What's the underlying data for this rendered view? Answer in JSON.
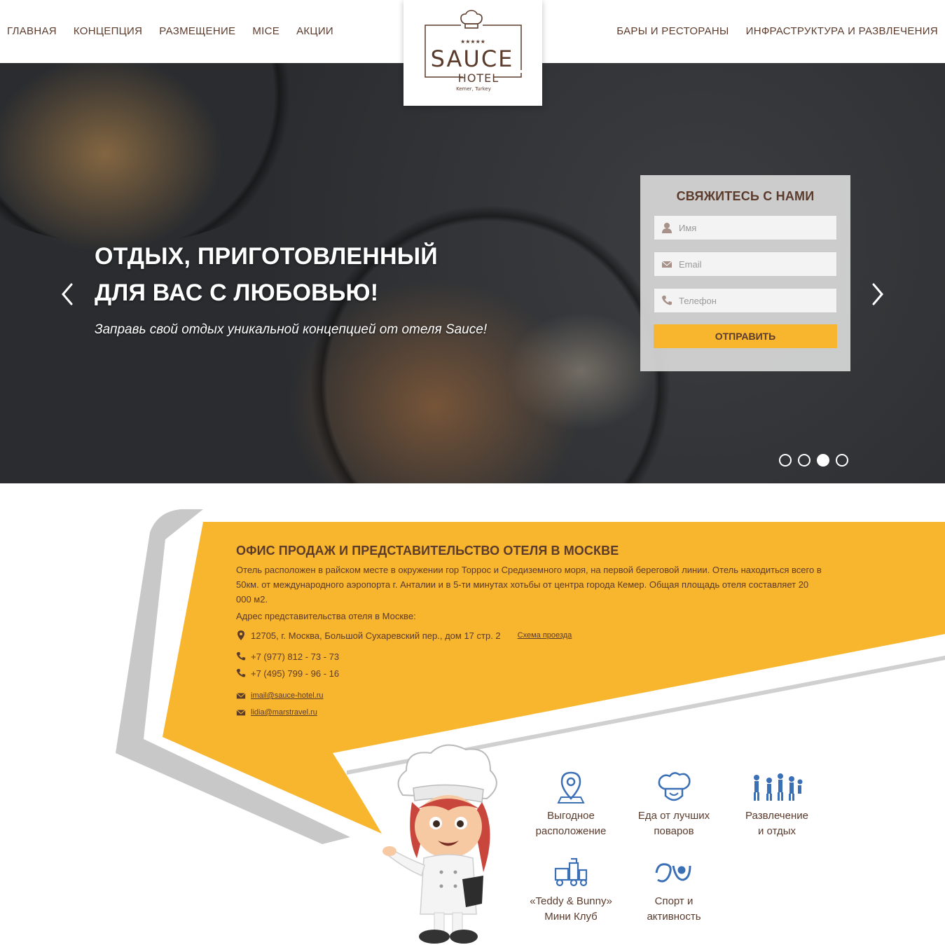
{
  "nav": {
    "left": [
      "ГЛАВНАЯ",
      "КОНЦЕПЦИЯ",
      "РАЗМЕЩЕНИЕ",
      "MICE",
      "АКЦИИ"
    ],
    "right": [
      "БАРЫ И РЕСТОРАНЫ",
      "ИНФРАСТРУКТУРА И РАЗВЛЕЧЕНИЯ"
    ]
  },
  "logo": {
    "stars": "★★★★★",
    "name": "SAUCE",
    "sub": "HOTEL",
    "location": "Kemer, Turkey"
  },
  "hero": {
    "title_line1": "ОТДЫХ, ПРИГОТОВЛЕННЫЙ",
    "title_line2": "ДЛЯ ВАС С ЛЮБОВЬЮ!",
    "subtitle": "Заправь свой отдых уникальной концепцией от отеля Sauce!",
    "slide_count": 4,
    "active_slide": 3,
    "prev_icon": "chevron-left-icon",
    "next_icon": "chevron-right-icon"
  },
  "contact_form": {
    "title": "СВЯЖИТЕСЬ С НАМИ",
    "name_placeholder": "Имя",
    "email_placeholder": "Email",
    "phone_placeholder": "Телефон",
    "submit_label": "ОТПРАВИТЬ"
  },
  "office": {
    "title": "ОФИС ПРОДАЖ И ПРЕДСТАВИТЕЛЬСТВО ОТЕЛЯ В МОСКВЕ",
    "description": "Отель расположен в райском месте в окружении гор Торрос и Средиземного моря, на первой береговой линии. Отель находиться всего в 50км. от международного аэропорта г. Анталии и в 5-ти минутах хотьбы от центра города Кемер. Общая площадь отеля составляет 20 000 м2.",
    "address_label": "Адрес представительства отеля в Москве:",
    "address": "12705, г. Москва, Большой Сухаревский пер., дом 17 стр. 2",
    "route_link": "Схема проезда",
    "phone1": "+7 (977) 812 - 73 - 73",
    "phone2": "+7 (495) 799 - 96 - 16",
    "email1": "imail@sauce-hotel.ru",
    "email2": "lidia@marstravel.ru"
  },
  "features": [
    {
      "line1": "Выгодное",
      "line2": "расположение",
      "icon": "location-pin-icon"
    },
    {
      "line1": "Еда от лучших",
      "line2": "поваров",
      "icon": "chef-hat-icon"
    },
    {
      "line1": "Развлечение",
      "line2": "и отдых",
      "icon": "people-dancing-icon"
    },
    {
      "line1": "«Teddy & Bunny»",
      "line2": "Мини Клуб",
      "icon": "toy-train-icon"
    },
    {
      "line1": "Спорт и",
      "line2": "активность",
      "icon": "sport-icon"
    }
  ],
  "colors": {
    "accent": "#f8b52e",
    "text": "#5b3b2c",
    "icon_blue": "#3b6fb6",
    "form_bg": "#d7d7d7"
  }
}
